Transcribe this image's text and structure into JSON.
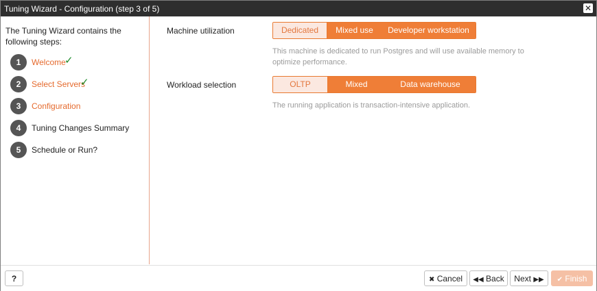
{
  "window": {
    "title": "Tuning Wizard - Configuration (step 3 of 5)",
    "close_symbol": "✕"
  },
  "sidebar": {
    "intro": "The Tuning Wizard contains the following steps:",
    "steps": [
      {
        "num": "1",
        "label": "Welcome",
        "state": "completed"
      },
      {
        "num": "2",
        "label": "Select Servers",
        "state": "completed"
      },
      {
        "num": "3",
        "label": "Configuration",
        "state": "current"
      },
      {
        "num": "4",
        "label": "Tuning Changes Summary",
        "state": "pending"
      },
      {
        "num": "5",
        "label": "Schedule or Run?",
        "state": "pending"
      }
    ],
    "check_symbol": "✓"
  },
  "main": {
    "machine_utilization": {
      "label": "Machine utilization",
      "options": [
        "Dedicated",
        "Mixed use",
        "Developer workstation"
      ],
      "selected": "Dedicated",
      "help": "This machine is dedicated to run Postgres and will use available memory to optimize performance."
    },
    "workload_selection": {
      "label": "Workload selection",
      "options": [
        "OLTP",
        "Mixed",
        "Data warehouse"
      ],
      "selected": "OLTP",
      "help": "The running application is transaction-intensive application."
    }
  },
  "footer": {
    "help_label": "?",
    "cancel_label": "Cancel",
    "back_label": "Back",
    "next_label": "Next",
    "finish_label": "Finish"
  },
  "colors": {
    "accent": "#ef7e37",
    "check": "#1e8c2c",
    "titlebar": "#2e2e2e"
  },
  "icons": {
    "close": "close-icon",
    "cancel": "times-icon",
    "back": "backward-icon",
    "next": "forward-icon",
    "finish": "check-icon"
  }
}
